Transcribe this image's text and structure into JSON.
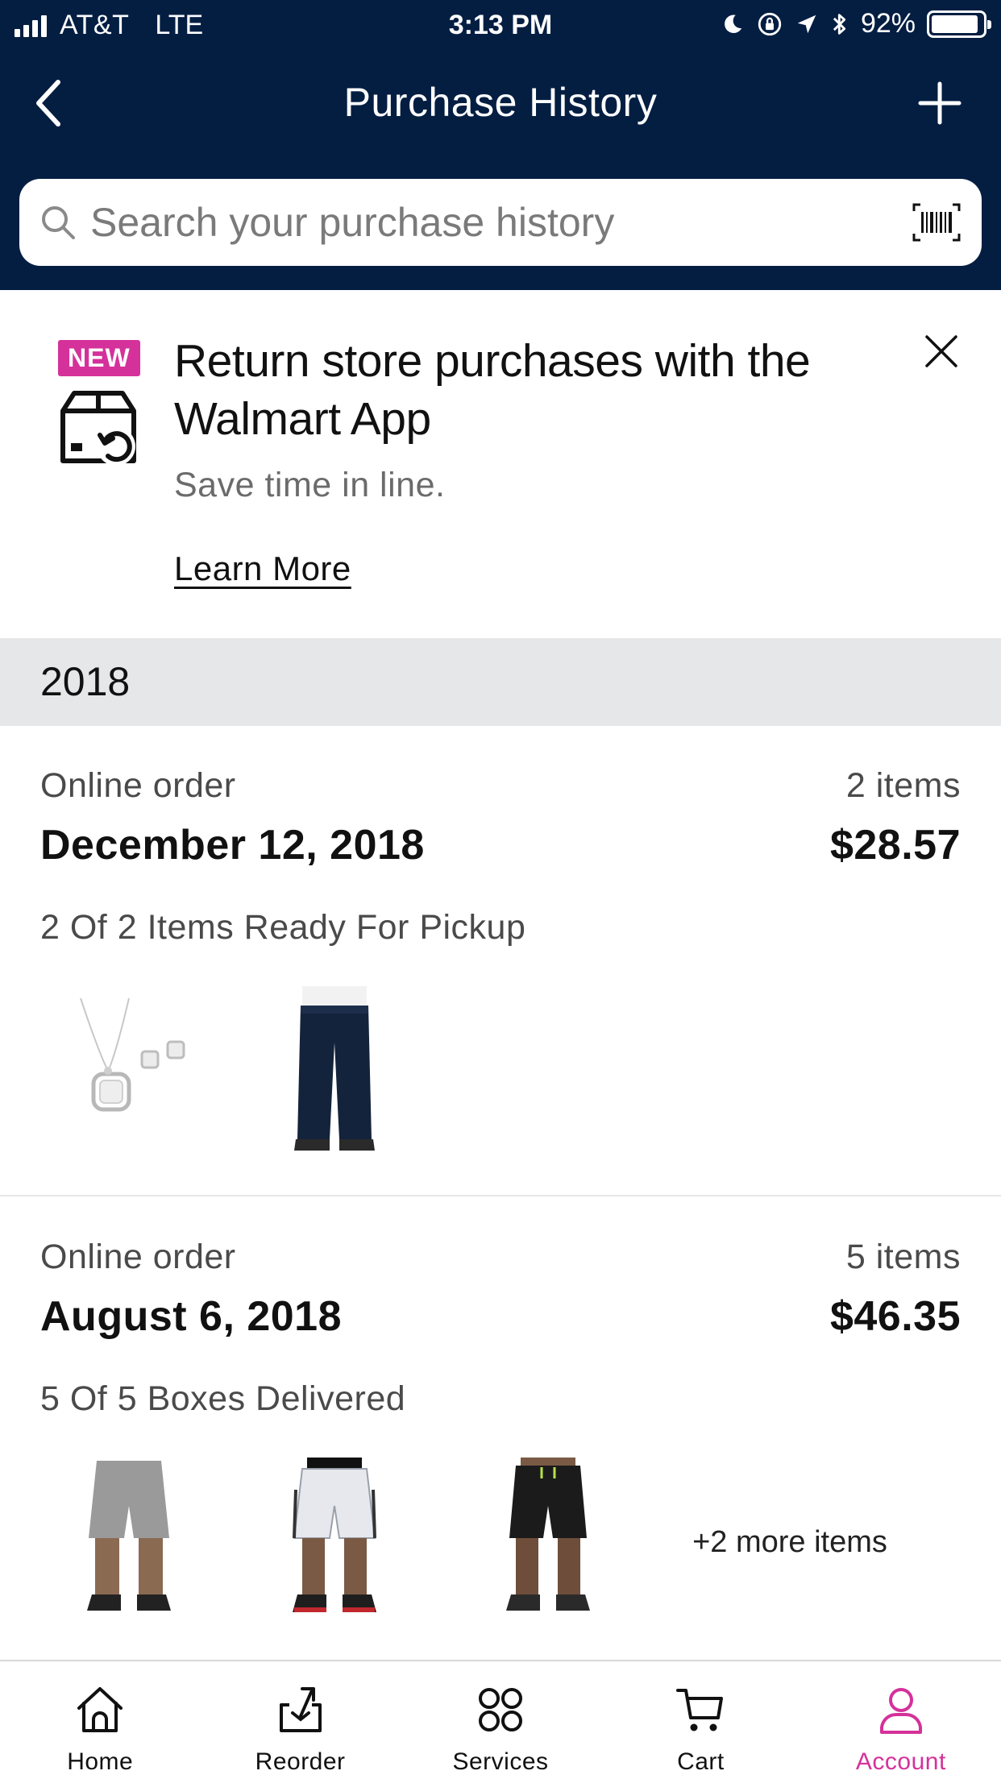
{
  "status_bar": {
    "carrier": "AT&T",
    "network": "LTE",
    "time": "3:13 PM",
    "battery_text": "92%",
    "battery_level": 0.92
  },
  "nav": {
    "title": "Purchase History",
    "back_icon": "chevron-left-icon",
    "add_icon": "plus-icon"
  },
  "search": {
    "placeholder": "Search your purchase history",
    "value": ""
  },
  "banner": {
    "badge": "NEW",
    "title": "Return store purchases with the Walmart App",
    "subtitle": "Save time in line.",
    "link": "Learn More"
  },
  "year": "2018",
  "orders": [
    {
      "type": "Online order",
      "count": "2 items",
      "date": "December 12, 2018",
      "total": "$28.57",
      "status": "2 Of 2 Items Ready For Pickup",
      "thumbnails": [
        "necklace-earrings-set",
        "dark-jeans"
      ],
      "more_items": ""
    },
    {
      "type": "Online order",
      "count": "5 items",
      "date": "August 6, 2018",
      "total": "$46.35",
      "status": "5 Of 5 Boxes Delivered",
      "thumbnails": [
        "gray-shorts",
        "white-basketball-shorts",
        "black-shorts"
      ],
      "more_items": "+2 more items"
    }
  ],
  "tabs": [
    {
      "label": "Home",
      "icon": "home-icon",
      "active": false
    },
    {
      "label": "Reorder",
      "icon": "reorder-icon",
      "active": false
    },
    {
      "label": "Services",
      "icon": "services-icon",
      "active": false
    },
    {
      "label": "Cart",
      "icon": "cart-icon",
      "active": false
    },
    {
      "label": "Account",
      "icon": "account-icon",
      "active": true
    }
  ],
  "colors": {
    "header_bg": "#041e42",
    "accent_pink": "#d5319a",
    "section_gray": "#e6e7e8"
  }
}
